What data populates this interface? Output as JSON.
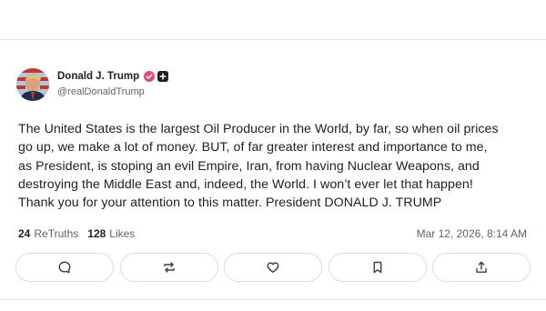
{
  "author": {
    "display_name": "Donald J. Trump",
    "handle": "@realDonaldTrump"
  },
  "post": {
    "lines": [
      "The United States is the largest Oil Producer in the World, by far, so when oil prices",
      "go up, we make a lot of money. BUT, of far greater interest and importance to me,",
      "as President, is stoping an evil Empire, Iran, from having Nuclear Weapons, and",
      "destroying the Middle East and, indeed, the World. I won’t ever let that happen!",
      "Thank you for your attention to this matter. President DONALD J. TRUMP"
    ]
  },
  "stats": {
    "retruths_count": "24",
    "retruths_label": "ReTruths",
    "likes_count": "128",
    "likes_label": "Likes"
  },
  "timestamp": "Mar 12, 2026, 8:14 AM",
  "actions": [
    {
      "name": "reply",
      "icon": "speech-bubble-icon"
    },
    {
      "name": "retruth",
      "icon": "repost-arrows-icon"
    },
    {
      "name": "like",
      "icon": "heart-icon"
    },
    {
      "name": "bookmark",
      "icon": "bookmark-icon"
    },
    {
      "name": "share",
      "icon": "share-upload-icon"
    }
  ],
  "colors": {
    "verified_badge": "#e3477b",
    "text_primary": "#1f1f1f",
    "text_secondary": "#5f6472",
    "border": "#dcdde3"
  }
}
